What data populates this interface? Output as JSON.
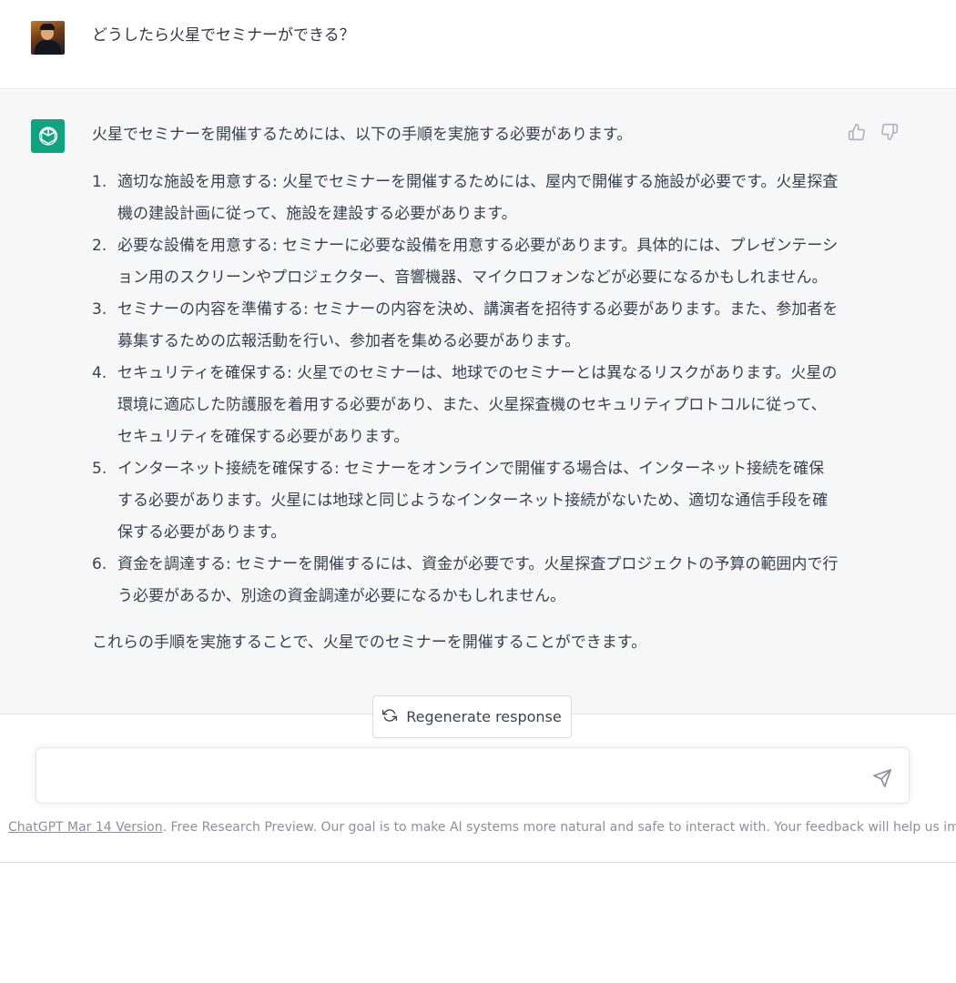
{
  "user_message": {
    "avatar": "user-avatar-photo",
    "text": "どうしたら火星でセミナーができる？"
  },
  "assistant_message": {
    "logo_icon": "openai-logo-icon",
    "intro": "火星でセミナーを開催するためには、以下の手順を実施する必要があります。",
    "steps": [
      {
        "num": "1.",
        "text": "適切な施設を用意する: 火星でセミナーを開催するためには、屋内で開催する施設が必要です。火星探査機の建設計画に従って、施設を建設する必要があります。"
      },
      {
        "num": "2.",
        "text": "必要な設備を用意する: セミナーに必要な設備を用意する必要があります。具体的には、プレゼンテーション用のスクリーンやプロジェクター、音響機器、マイクロフォンなどが必要になるかもしれません。"
      },
      {
        "num": "3.",
        "text": "セミナーの内容を準備する: セミナーの内容を決め、講演者を招待する必要があります。また、参加者を募集するための広報活動を行い、参加者を集める必要があります。"
      },
      {
        "num": "4.",
        "text": "セキュリティを確保する: 火星でのセミナーは、地球でのセミナーとは異なるリスクがあります。火星の環境に適応した防護服を着用する必要があり、また、火星探査機のセキュリティプロトコルに従って、セキュリティを確保する必要があります。"
      },
      {
        "num": "5.",
        "text": "インターネット接続を確保する: セミナーをオンラインで開催する場合は、インターネット接続を確保する必要があります。火星には地球と同じようなインターネット接続がないため、適切な通信手段を確保する必要があります。"
      },
      {
        "num": "6.",
        "text": "資金を調達する: セミナーを開催するには、資金が必要です。火星探査プロジェクトの予算の範囲内で行う必要があるか、別途の資金調達が必要になるかもしれません。"
      }
    ],
    "outro": "これらの手順を実施することで、火星でのセミナーを開催することができます。",
    "feedback_icons": [
      "thumbs-up-icon",
      "thumbs-down-icon"
    ]
  },
  "regenerate": {
    "label": "Regenerate response",
    "icon": "refresh-icon"
  },
  "composer": {
    "value": "",
    "placeholder": "",
    "send_icon": "send-icon"
  },
  "footer": {
    "link_text": "ChatGPT Mar 14 Version",
    "text": ". Free Research Preview. Our goal is to make AI systems more natural and safe to interact with. Your feedback will help us improve."
  },
  "colors": {
    "brand": "#10a37f",
    "assistant_bg": "#f7f7f8",
    "text": "#374151",
    "muted": "#8e8ea0"
  }
}
